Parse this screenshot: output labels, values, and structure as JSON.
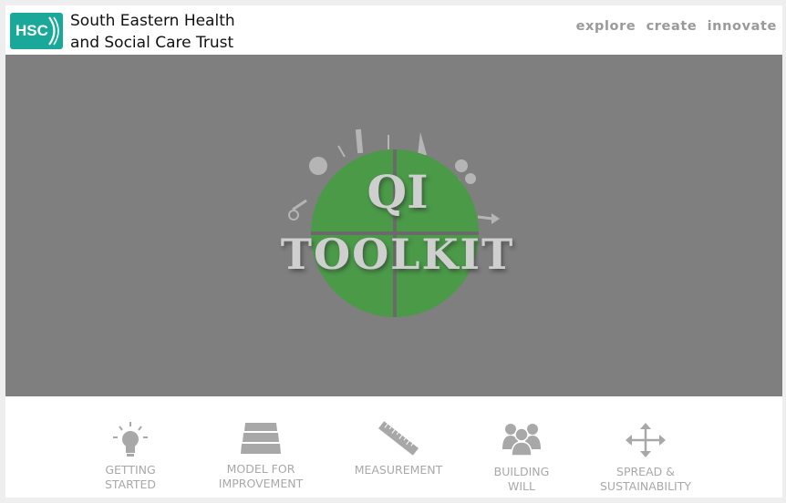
{
  "header": {
    "logo_text": "HSC",
    "trust_name_line1": "South Eastern Health",
    "trust_name_line2": "and Social Care Trust",
    "tagline": "explore  create  innovate"
  },
  "hero": {
    "logo_line1": "QI",
    "logo_line2": "TOOLKIT"
  },
  "nav": {
    "items": [
      {
        "line1": "GETTING",
        "line2": "STARTED",
        "icon": "lightbulb-icon"
      },
      {
        "line1": "MODEL FOR",
        "line2": "IMPROVEMENT",
        "icon": "stacked-layers-icon"
      },
      {
        "line1": "MEASUREMENT",
        "line2": "",
        "icon": "ruler-icon"
      },
      {
        "line1": "BUILDING",
        "line2": "WILL",
        "icon": "people-group-icon"
      },
      {
        "line1": "SPREAD &",
        "line2": "SUSTAINABILITY",
        "icon": "move-arrows-icon"
      }
    ]
  },
  "colors": {
    "brand_teal": "#1aa89a",
    "hero_gray": "#7f7f7f",
    "logo_green": "#4a9a48",
    "nav_gray": "#a8a8a8"
  }
}
